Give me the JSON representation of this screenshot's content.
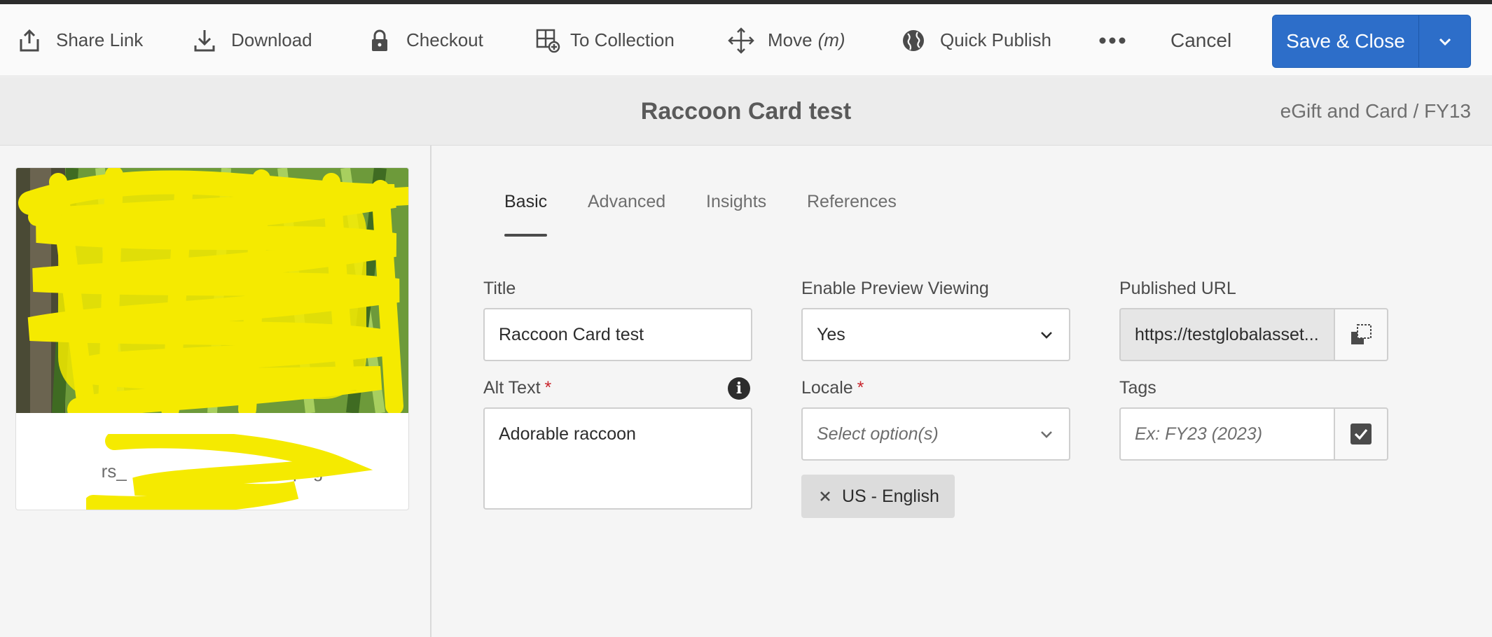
{
  "toolbar": {
    "share_link": "Share Link",
    "download": "Download",
    "checkout": "Checkout",
    "to_collection": "To Collection",
    "move": "Move",
    "move_shortcut": "(m)",
    "quick_publish": "Quick Publish",
    "cancel": "Cancel",
    "save_close": "Save & Close"
  },
  "header": {
    "title": "Raccoon Card test",
    "breadcrumb": "eGift and Card / FY13"
  },
  "card": {
    "name_prefix": "rs_",
    "name_suffix": ".png"
  },
  "tabs": [
    "Basic",
    "Advanced",
    "Insights",
    "References"
  ],
  "form": {
    "title_label": "Title",
    "title_value": "Raccoon Card test",
    "alt_label": "Alt Text",
    "alt_value": "Adorable raccoon",
    "preview_label": "Enable Preview Viewing",
    "preview_value": "Yes",
    "locale_label": "Locale",
    "locale_placeholder": "Select option(s)",
    "locale_tag": "US - English",
    "url_label": "Published URL",
    "url_value": "https://testglobalasset...",
    "tags_label": "Tags",
    "tags_placeholder": "Ex: FY23 (2023)",
    "required_mark": "*"
  },
  "colors": {
    "primary": "#2d6ec9",
    "required": "#c9252d",
    "scribble": "#f5ea00"
  }
}
